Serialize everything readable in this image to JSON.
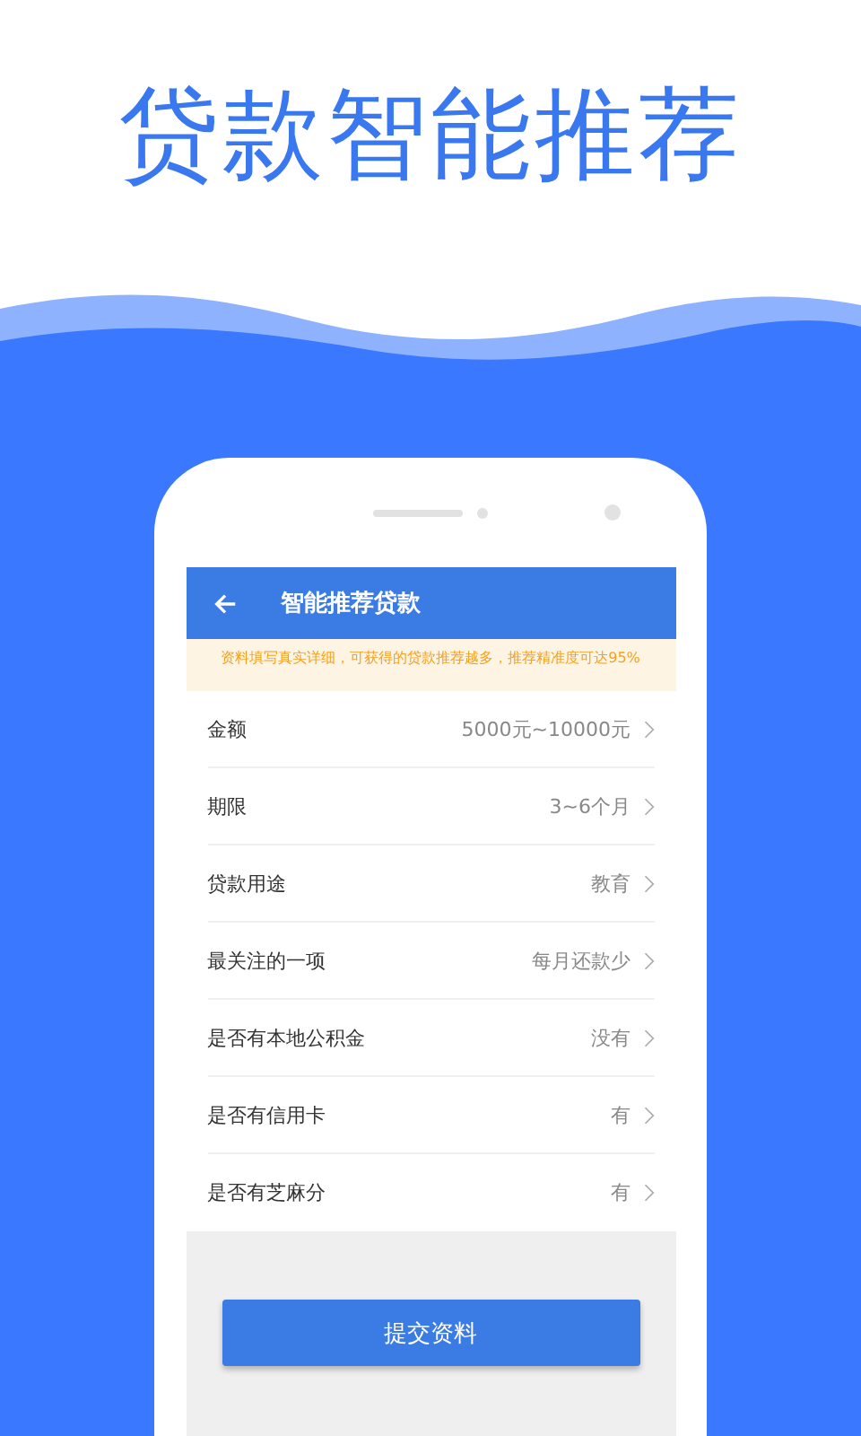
{
  "headline": "贷款智能推荐",
  "app_bar": {
    "title": "智能推荐贷款"
  },
  "notice": "资料填写真实详细，可获得的贷款推荐越多，推荐精准度可达95%",
  "rows": [
    {
      "label": "金额",
      "value": "5000元~10000元"
    },
    {
      "label": "期限",
      "value": "3~6个月"
    },
    {
      "label": "贷款用途",
      "value": "教育"
    },
    {
      "label": "最关注的一项",
      "value": "每月还款少"
    },
    {
      "label": "是否有本地公积金",
      "value": "没有"
    },
    {
      "label": "是否有信用卡",
      "value": "有"
    },
    {
      "label": "是否有芝麻分",
      "value": "有"
    }
  ],
  "submit_button": "提交资料"
}
